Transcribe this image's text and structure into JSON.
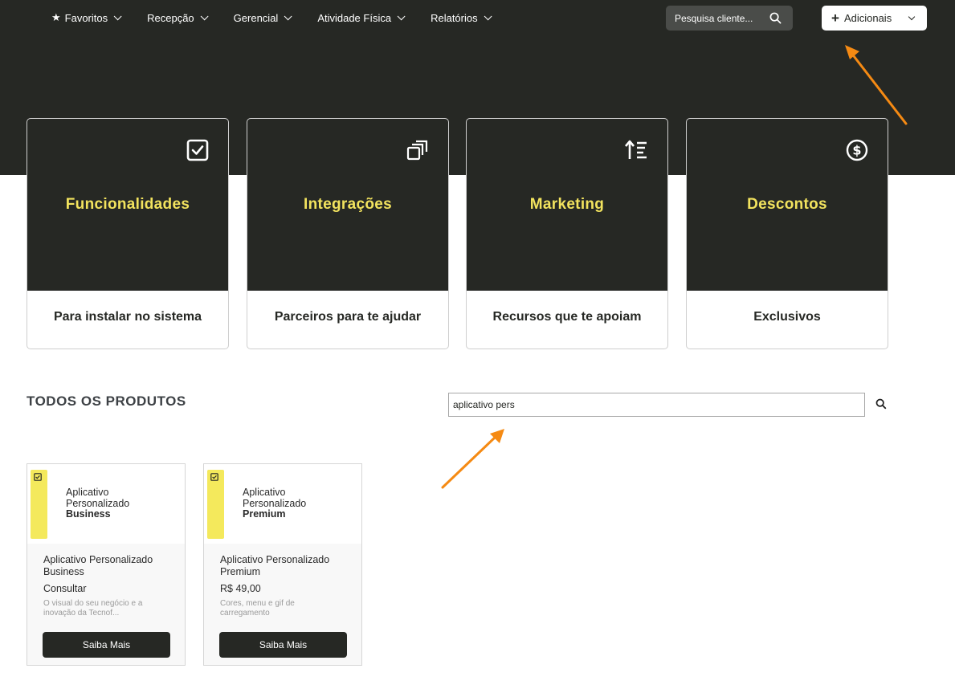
{
  "nav": {
    "items": [
      {
        "label": "Favoritos",
        "icon": "star-icon"
      },
      {
        "label": "Recepção"
      },
      {
        "label": "Gerencial"
      },
      {
        "label": "Atividade Física"
      },
      {
        "label": "Relatórios"
      }
    ],
    "search_placeholder": "Pesquisa cliente...",
    "adicionais_label": "Adicionais"
  },
  "categories": [
    {
      "title": "Funcionalidades",
      "subtitle": "Para instalar no sistema",
      "icon": "checkbox-icon"
    },
    {
      "title": "Integrações",
      "subtitle": "Parceiros para te ajudar",
      "icon": "layers-icon"
    },
    {
      "title": "Marketing",
      "subtitle": "Recursos que te apoiam",
      "icon": "sort-list-icon"
    },
    {
      "title": "Descontos",
      "subtitle": "Exclusivos",
      "icon": "dollar-circle-icon"
    }
  ],
  "products_section": {
    "title": "TODOS OS PRODUTOS",
    "search_value": "aplicativo pers"
  },
  "products": [
    {
      "image_line1": "Aplicativo",
      "image_line2": "Personalizado",
      "image_line3": "Business",
      "name": "Aplicativo Personalizado Business",
      "price": "Consultar",
      "description": "O visual do seu negócio e a inovação da Tecnof...",
      "button": "Saiba Mais"
    },
    {
      "image_line1": "Aplicativo",
      "image_line2": "Personalizado",
      "image_line3": "Premium",
      "name": "Aplicativo Personalizado Premium",
      "price": "R$ 49,00",
      "description": "Cores, menu e gif de carregamento",
      "button": "Saiba Mais"
    }
  ],
  "colors": {
    "dark": "#262824",
    "accent_yellow": "#f2e35e",
    "annotation_arrow": "#f58a13"
  }
}
